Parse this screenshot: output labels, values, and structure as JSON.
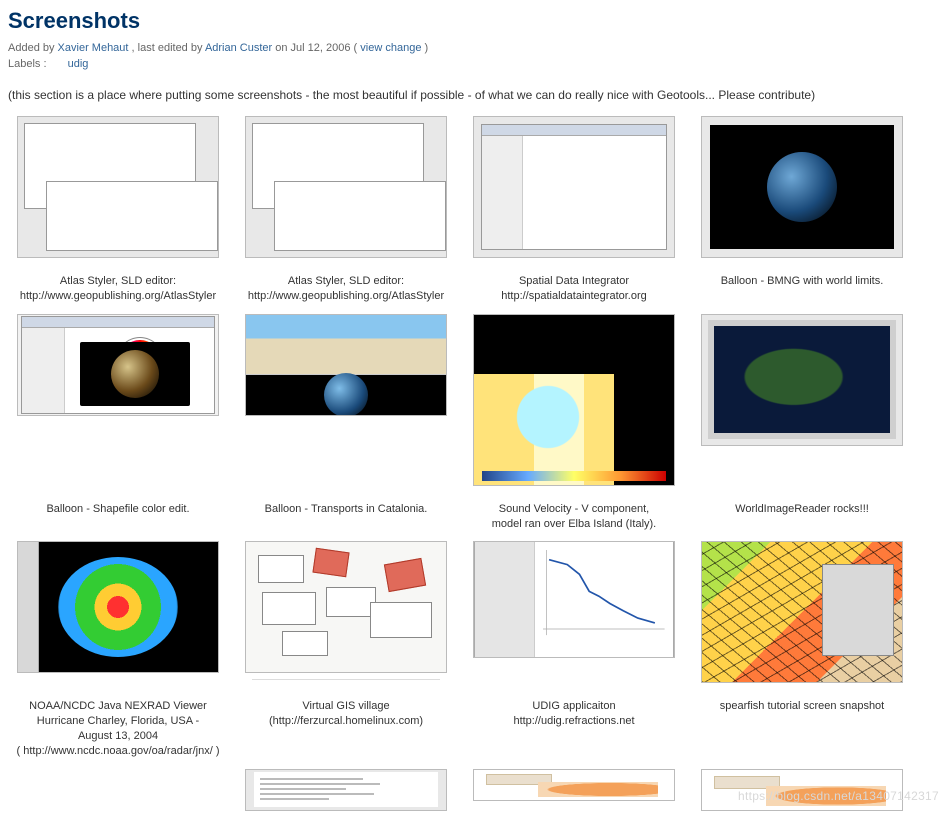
{
  "page": {
    "title": "Screenshots",
    "meta_prefix": "Added by ",
    "author1": "Xavier Mehaut",
    "meta_mid": ", last edited by ",
    "author2": "Adrian Custer",
    "meta_date": " on Jul 12, 2006  (",
    "view_change": "view change",
    "meta_close": ")",
    "labels_key": "Labels :",
    "label_udig": "udig",
    "intro": "(this section is a place where putting some screenshots - the most beautiful if possible - of what we can do really nice with Geotools... Please contribute)"
  },
  "grid": {
    "r1c1": {
      "line1": "Atlas Styler, SLD editor:",
      "line2": "http://www.geopublishing.org/AtlasStyler"
    },
    "r1c2": {
      "line1": "Atlas Styler, SLD editor:",
      "line2": "http://www.geopublishing.org/AtlasStyler"
    },
    "r1c3": {
      "line1": "Spatial Data Integrator",
      "line2": "http://spatialdataintegrator.org"
    },
    "r1c4": {
      "line1": "Balloon - BMNG with world limits."
    },
    "r2c1": {
      "line1": "Balloon - Shapefile color edit."
    },
    "r2c2": {
      "line1": "Balloon - Transports in Catalonia."
    },
    "r2c3": {
      "line1": "Sound Velocity - V component,",
      "line2": "model ran over Elba Island (Italy)."
    },
    "r2c4": {
      "line1": "WorldImageReader rocks!!!"
    },
    "r3c1": {
      "line1": "NOAA/NCDC Java NEXRAD Viewer",
      "line2": "Hurricane Charley, Florida, USA -",
      "line3": "August 13, 2004",
      "line4": "(  http://www.ncdc.noaa.gov/oa/radar/jnx/  )"
    },
    "r3c2": {
      "line1": "Virtual GIS village",
      "line2": "(http://ferzurcal.homelinux.com)"
    },
    "r3c3": {
      "line1": "UDIG applicaiton",
      "line2": "http://udig.refractions.net"
    },
    "r3c4": {
      "line1": "spearfish tutorial screen snapshot"
    }
  },
  "watermark": "https://blog.csdn.net/a13407142317"
}
